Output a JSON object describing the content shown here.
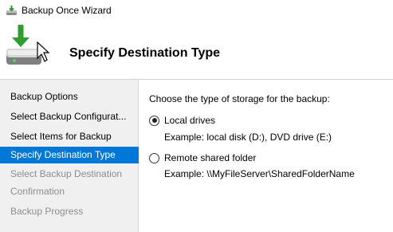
{
  "window": {
    "title": "Backup Once Wizard",
    "app_icon": "backup-wizard-icon"
  },
  "header": {
    "title": "Specify Destination Type",
    "icon": "backup-drive-icon"
  },
  "sidebar": {
    "steps": [
      {
        "label": "Backup Options",
        "state": "normal"
      },
      {
        "label": "Select Backup Configurat...",
        "state": "normal"
      },
      {
        "label": "Select Items for Backup",
        "state": "normal"
      },
      {
        "label": "Specify Destination Type",
        "state": "active"
      },
      {
        "label": "Select Backup Destination",
        "state": "disabled"
      },
      {
        "label": "Confirmation",
        "state": "disabled"
      },
      {
        "label": "Backup Progress",
        "state": "disabled"
      }
    ],
    "active_color": "#0078d7"
  },
  "main": {
    "prompt": "Choose the type of storage for the backup:",
    "options": [
      {
        "label": "Local drives",
        "example": "Example: local disk (D:), DVD drive (E:)",
        "selected": true
      },
      {
        "label": "Remote shared folder",
        "example": "Example: \\\\MyFileServer\\SharedFolderName",
        "selected": false
      }
    ]
  }
}
